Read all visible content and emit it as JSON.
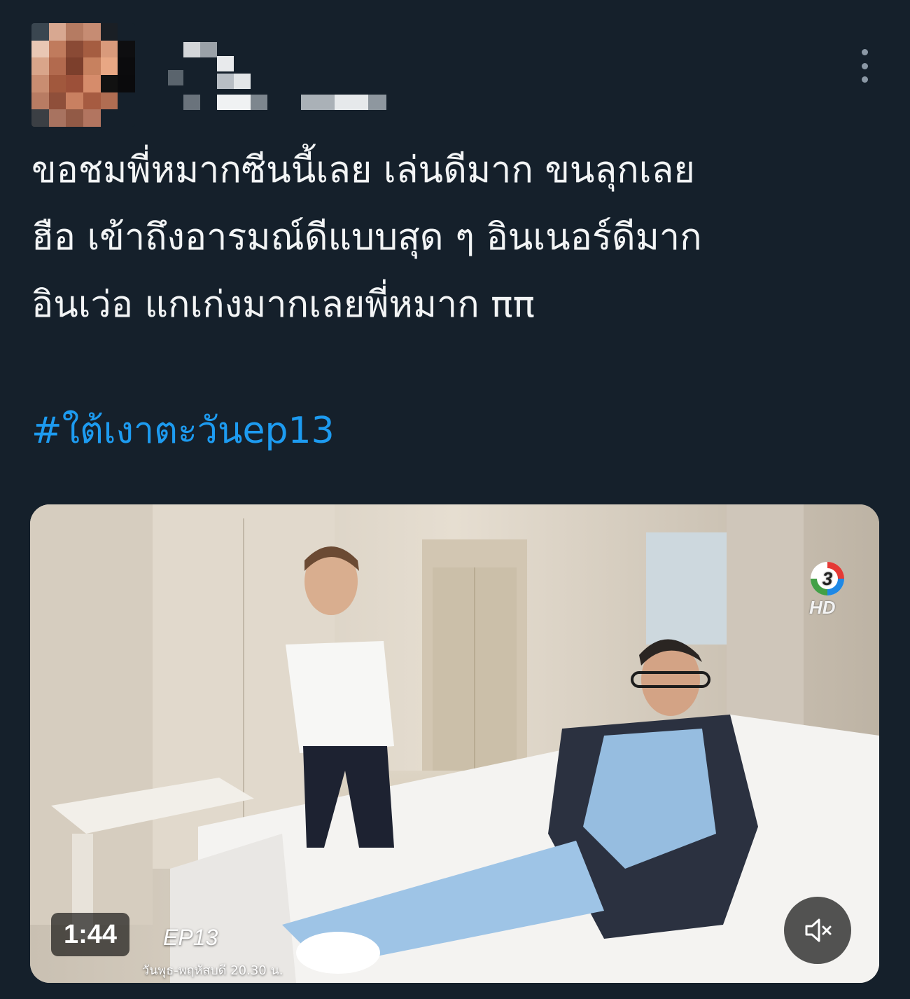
{
  "tweet": {
    "text_lines": [
      "ขอชมพี่หมากซีนนี้เลย เล่นดีมาก ขนลุกเลย",
      "ฮือ เข้าถึงอารมณ์ดีแบบสุด ๆ อินเนอร์ดีมาก",
      "อินเว่อ แกเก่งมากเลยพี่หมาก ππ"
    ],
    "hashtag": "#ใต้เงาตะวันep13"
  },
  "video": {
    "timestamp": "1:44",
    "overlay_episode": "EP13",
    "overlay_schedule": "วันพุธ-พฤหัสบดี 20.30 น.",
    "channel_logo": "channel-3-logo",
    "channel_hd": "HD",
    "mute_icon": "speaker-muted-icon"
  },
  "colors": {
    "background": "#15202b",
    "text": "#f2f4f5",
    "link": "#1d9bf0",
    "icon": "#8b98a5"
  }
}
